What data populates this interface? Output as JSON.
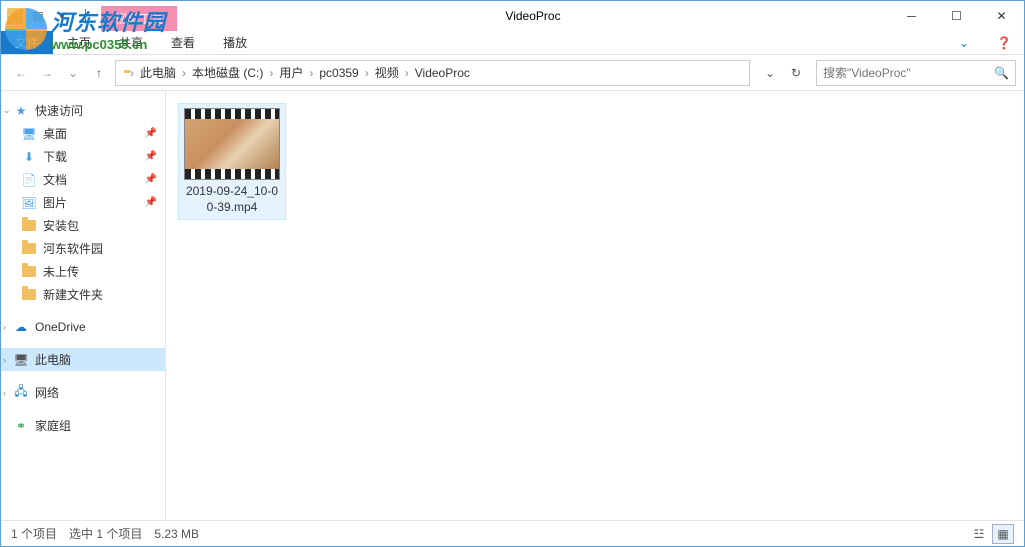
{
  "window": {
    "context_tab": "视频工具",
    "title": "VideoProc",
    "ribbon": {
      "file": "文件",
      "tabs": [
        "主页",
        "共享",
        "查看"
      ],
      "context_tabs": [
        "播放"
      ]
    }
  },
  "watermark": {
    "title": "河东软件园",
    "url": "www.pc0359.cn"
  },
  "address": {
    "crumbs": [
      "此电脑",
      "本地磁盘 (C:)",
      "用户",
      "pc0359",
      "视频",
      "VideoProc"
    ],
    "search_placeholder": "搜索\"VideoProc\""
  },
  "sidebar": {
    "quick_access": "快速访问",
    "items": [
      {
        "label": "桌面",
        "pinned": true,
        "icon": "desktop"
      },
      {
        "label": "下载",
        "pinned": true,
        "icon": "download"
      },
      {
        "label": "文档",
        "pinned": true,
        "icon": "document"
      },
      {
        "label": "图片",
        "pinned": true,
        "icon": "pictures"
      },
      {
        "label": "安装包",
        "pinned": false,
        "icon": "folder"
      },
      {
        "label": "河东软件园",
        "pinned": false,
        "icon": "folder"
      },
      {
        "label": "未上传",
        "pinned": false,
        "icon": "folder"
      },
      {
        "label": "新建文件夹",
        "pinned": false,
        "icon": "folder"
      }
    ],
    "onedrive": "OneDrive",
    "this_pc": "此电脑",
    "network": "网络",
    "homegroup": "家庭组"
  },
  "files": [
    {
      "name": "2019-09-24_10-00-39.mp4"
    }
  ],
  "statusbar": {
    "count": "1 个项目",
    "selection": "选中 1 个项目",
    "size": "5.23 MB"
  }
}
